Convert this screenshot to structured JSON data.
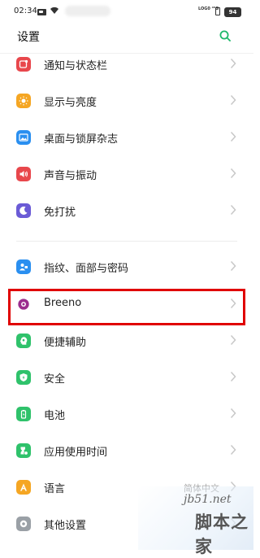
{
  "status": {
    "time": "02:34",
    "wifi_icon": "wifi-icon",
    "network": "LOG0 ⁴⁶G",
    "battery": "94"
  },
  "header": {
    "title": "设置",
    "search_icon": "search-icon",
    "accent": "#1db86a"
  },
  "items": [
    {
      "label": "通知与状态栏",
      "icon": "notification-icon",
      "color": "#e8474c"
    },
    {
      "label": "显示与亮度",
      "icon": "brightness-icon",
      "color": "#f5a623"
    },
    {
      "label": "桌面与锁屏杂志",
      "icon": "wallpaper-icon",
      "color": "#2a8ff0"
    },
    {
      "label": "声音与振动",
      "icon": "sound-icon",
      "color": "#e8474c"
    },
    {
      "label": "免打扰",
      "icon": "moon-icon",
      "color": "#6b5bd6"
    },
    {
      "label": "指纹、面部与密码",
      "icon": "fingerprint-icon",
      "color": "#2a8ff0"
    },
    {
      "label": "Breeno",
      "icon": "breeno-icon",
      "color": "#9b2d8e"
    },
    {
      "label": "便捷辅助",
      "icon": "assist-icon",
      "color": "#2fc26b"
    },
    {
      "label": "安全",
      "icon": "shield-icon",
      "color": "#2fc26b"
    },
    {
      "label": "电池",
      "icon": "battery-icon",
      "color": "#2fc26b"
    },
    {
      "label": "应用使用时间",
      "icon": "hourglass-icon",
      "color": "#2fc26b"
    },
    {
      "label": "语言",
      "icon": "language-icon",
      "color": "#f5a623",
      "value": "简体中文"
    },
    {
      "label": "其他设置",
      "icon": "more-settings-icon",
      "color": "#9aa0a6"
    }
  ],
  "highlight_color": "#e00000",
  "watermark": {
    "url": "jb51.net",
    "text": "脚本之家"
  }
}
